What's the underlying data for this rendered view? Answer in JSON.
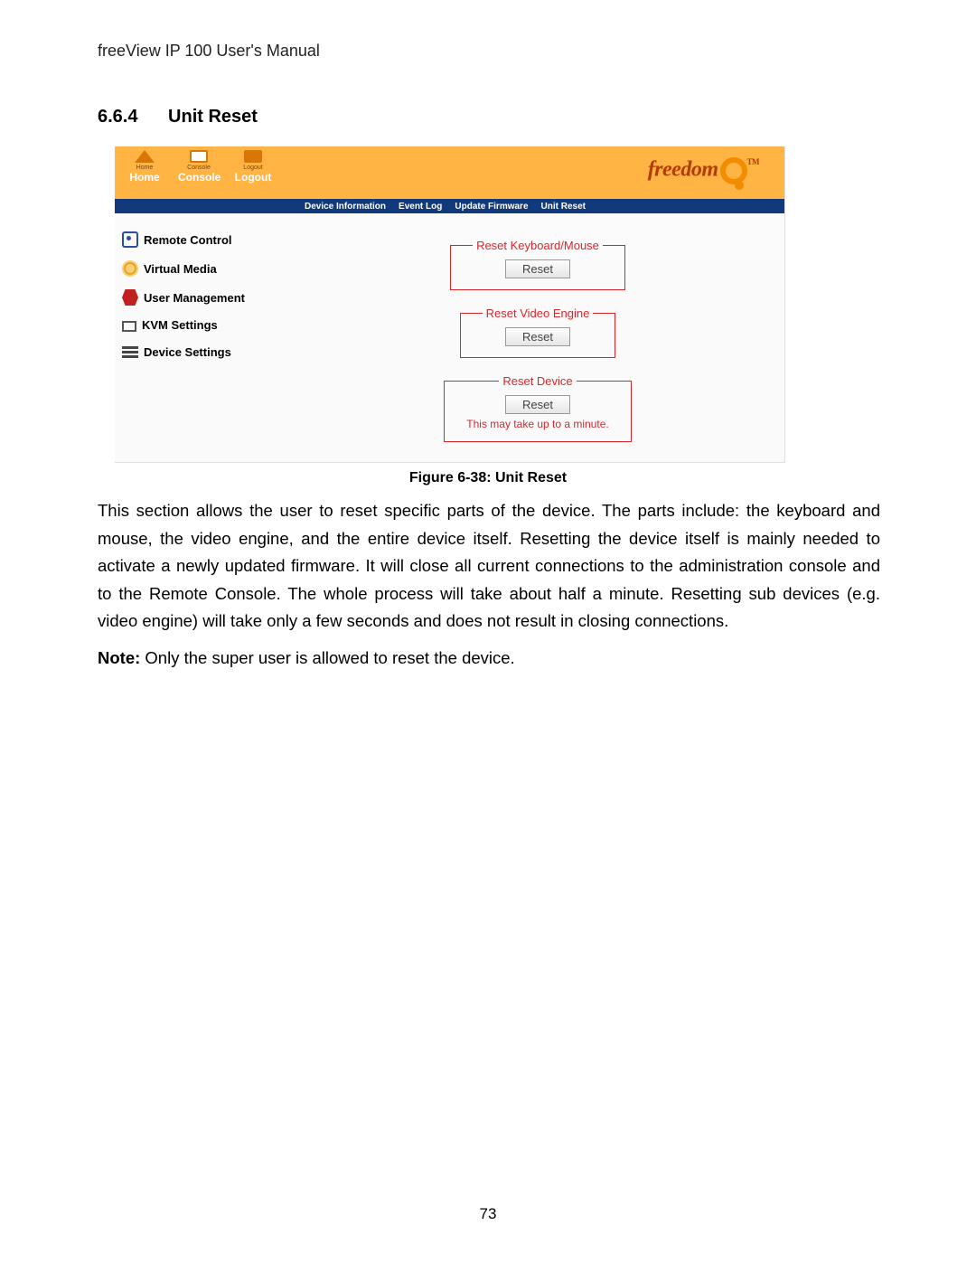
{
  "doc": {
    "running_header": "freeView IP 100 User's Manual",
    "section_number": "6.6.4",
    "section_title": "Unit Reset",
    "figure_caption": "Figure 6-38: Unit Reset",
    "body_paragraph": "This section allows the user to reset specific parts of the device. The parts include: the keyboard and mouse, the video engine, and the entire device itself. Resetting the device itself is mainly needed to activate a newly updated firmware. It will close all current connections to the administration console and to the Remote Console. The whole process will take about half a minute. Resetting sub devices (e.g. video engine) will take only a few seconds and does not result in closing connections.",
    "note_label": "Note:",
    "note_text": " Only the super user is allowed to reset the device.",
    "page_number": "73"
  },
  "ui": {
    "top_nav": {
      "items": [
        {
          "small": "Home",
          "label": "Home"
        },
        {
          "small": "Console",
          "label": "Console"
        },
        {
          "small": "Logout",
          "label": "Logout"
        }
      ]
    },
    "brand_text": "freedom",
    "brand_tm": "TM",
    "subnav": [
      "Device Information",
      "Event Log",
      "Update Firmware",
      "Unit Reset"
    ],
    "sidebar": [
      "Remote Control",
      "Virtual Media",
      "User Management",
      "KVM Settings",
      "Device Settings"
    ],
    "resets": {
      "kb_mouse": {
        "legend": "Reset Keyboard/Mouse",
        "button": "Reset"
      },
      "video": {
        "legend": "Reset Video Engine",
        "button": "Reset"
      },
      "device": {
        "legend": "Reset Device",
        "button": "Reset",
        "warn": "This may take up to a minute."
      }
    }
  }
}
